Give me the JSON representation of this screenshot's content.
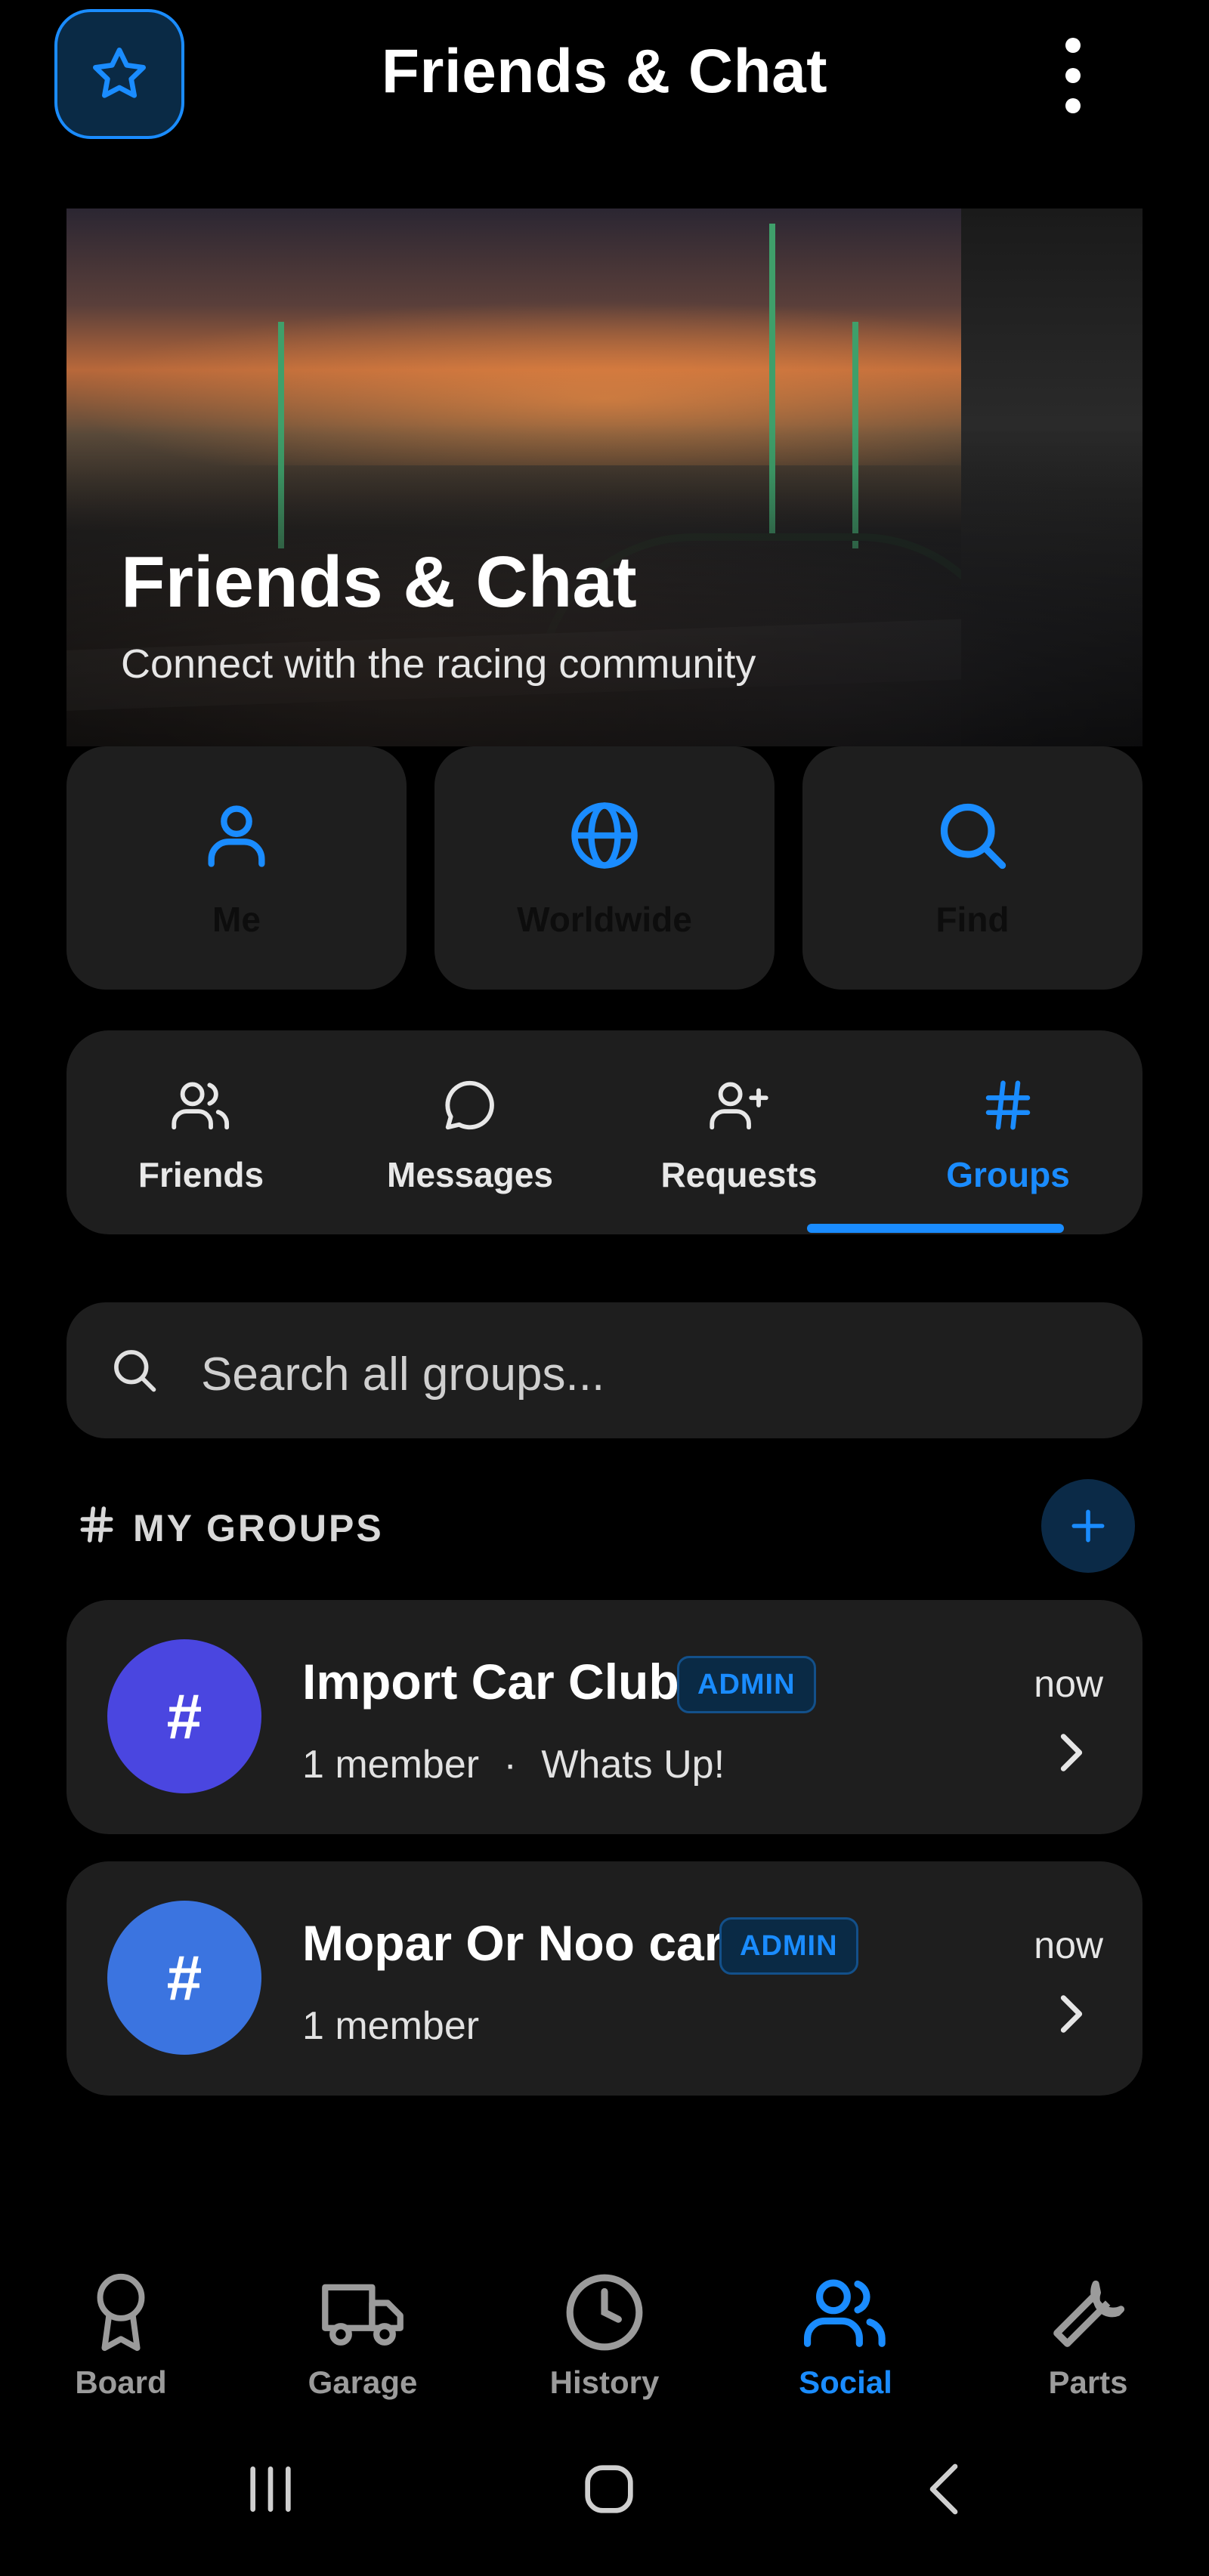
{
  "header": {
    "title": "Friends & Chat",
    "favorite_icon": "star-icon",
    "menu_icon": "more-vertical-icon"
  },
  "hero": {
    "title": "Friends & Chat",
    "subtitle": "Connect with the racing community"
  },
  "quick_actions": [
    {
      "label": "Me",
      "icon": "user-icon"
    },
    {
      "label": "Worldwide",
      "icon": "globe-icon"
    },
    {
      "label": "Find",
      "icon": "search-icon"
    }
  ],
  "tabs": [
    {
      "label": "Friends",
      "icon": "users-icon",
      "active": false
    },
    {
      "label": "Messages",
      "icon": "chat-bubble-icon",
      "active": false
    },
    {
      "label": "Requests",
      "icon": "user-plus-icon",
      "active": false
    },
    {
      "label": "Groups",
      "icon": "hash-icon",
      "active": true
    }
  ],
  "search": {
    "placeholder": "Search all groups..."
  },
  "my_groups": {
    "title": "MY GROUPS",
    "items": [
      {
        "name": "Import Car Club",
        "badge": "ADMIN",
        "members": "1 member",
        "separator": "·",
        "last_message": "Whats Up!",
        "time": "now",
        "avatar_symbol": "#",
        "avatar_color": "#4a46e0"
      },
      {
        "name": "Mopar Or Noo car",
        "badge": "ADMIN",
        "members": "1 member",
        "time": "now",
        "avatar_symbol": "#",
        "avatar_color": "#3b74e0"
      }
    ]
  },
  "bottom_nav": [
    {
      "label": "Board",
      "icon": "award-icon",
      "active": false
    },
    {
      "label": "Garage",
      "icon": "truck-icon",
      "active": false
    },
    {
      "label": "History",
      "icon": "clock-icon",
      "active": false
    },
    {
      "label": "Social",
      "icon": "users-icon",
      "active": true
    },
    {
      "label": "Parts",
      "icon": "wrench-icon",
      "active": false
    }
  ],
  "colors": {
    "accent": "#1a8cff",
    "card": "#1e1e1e",
    "background": "#000000"
  }
}
